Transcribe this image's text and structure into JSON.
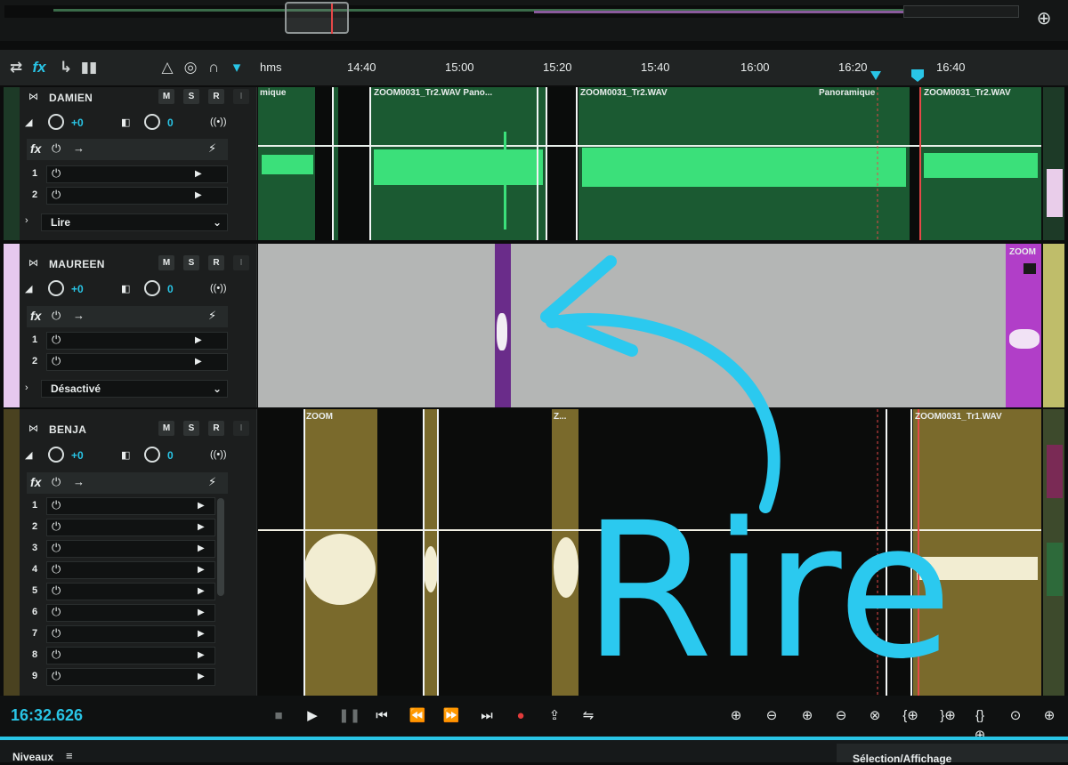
{
  "ruler": {
    "unit": "hms",
    "ticks": [
      "14:40",
      "15:00",
      "15:20",
      "15:40",
      "16:00",
      "16:20",
      "16:40"
    ]
  },
  "tracks": [
    {
      "name": "DAMIEN",
      "buttons": [
        "M",
        "S",
        "R",
        "I"
      ],
      "volume": "+0",
      "pan": "0",
      "fx_label": "fx",
      "sends": [
        "1",
        "2"
      ],
      "mode": "Lire",
      "color": "#1d6b3c",
      "clips": [
        "mique",
        "ZOOM0031_Tr2.WAV Pano...",
        "ZOOM0031_Tr2.WAV",
        "Panoramique",
        "ZOOM0031_Tr2.WAV"
      ]
    },
    {
      "name": "MAUREEN",
      "buttons": [
        "M",
        "S",
        "R",
        "I"
      ],
      "volume": "+0",
      "pan": "0",
      "fx_label": "fx",
      "sends": [
        "1",
        "2"
      ],
      "mode": "Désactivé",
      "color": "#b13ec8",
      "clips": [
        "ZOOM"
      ]
    },
    {
      "name": "BENJA",
      "buttons": [
        "M",
        "S",
        "R",
        "I"
      ],
      "volume": "+0",
      "pan": "0",
      "fx_label": "fx",
      "sends": [
        "1",
        "2",
        "3",
        "4",
        "5",
        "6",
        "7",
        "8",
        "9"
      ],
      "color": "#7a6a2c",
      "clips": [
        "ZOOM",
        "Z...",
        "ZOOM0031_Tr1.WAV"
      ]
    }
  ],
  "transport": {
    "timecode": "16:32.626"
  },
  "status": {
    "left": "Niveaux",
    "right": "Sélection/Affichage"
  },
  "annotation": {
    "text": "Rire",
    "color": "#29c5e6"
  }
}
